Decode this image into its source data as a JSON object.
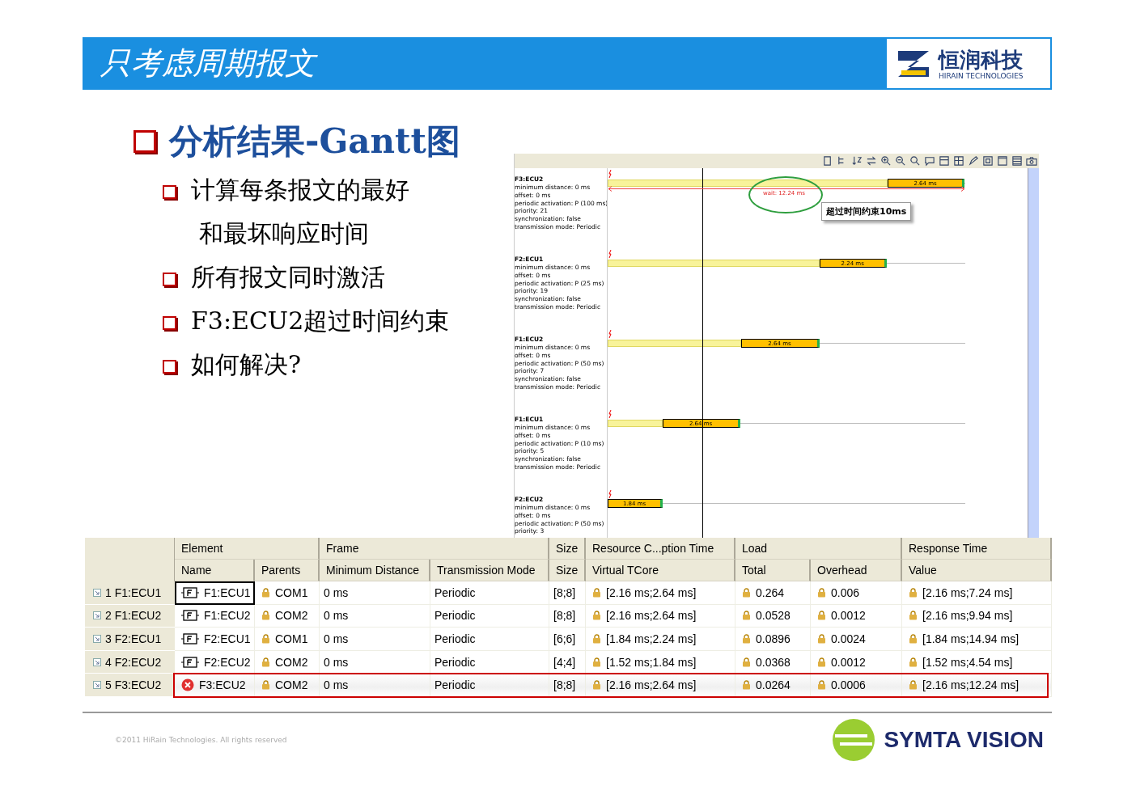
{
  "header": {
    "title": "只考虑周期报文",
    "logo": {
      "name": "恒润科技",
      "tagline": "HIRAIN TECHNOLOGIES"
    }
  },
  "heading": "分析结果-Gantt图",
  "bullets": [
    {
      "lines": [
        "计算每条报文的最好",
        "和最坏响应时间"
      ]
    },
    {
      "lines": [
        "所有报文同时激活"
      ]
    },
    {
      "lines": [
        "F3:ECU2超过时间约束"
      ]
    },
    {
      "lines": [
        "如何解决?"
      ]
    }
  ],
  "gantt": {
    "rows": [
      {
        "name": "F3:ECU2",
        "properties": [
          "minimum distance: 0 ms",
          "offset: 0 ms",
          "periodic activation: P (100 ms)",
          "priority: 21",
          "synchronization: false",
          "transmission mode: Periodic"
        ],
        "bar_label": "2.64 ms"
      },
      {
        "name": "F2:ECU1",
        "properties": [
          "minimum distance: 0 ms",
          "offset: 0 ms",
          "periodic activation: P (25 ms)",
          "priority: 19",
          "synchronization: false",
          "transmission mode: Periodic"
        ],
        "bar_label": "2.24 ms"
      },
      {
        "name": "F1:ECU2",
        "properties": [
          "minimum distance: 0 ms",
          "offset: 0 ms",
          "periodic activation: P (50 ms)",
          "priority: 7",
          "synchronization: false",
          "transmission mode: Periodic"
        ],
        "bar_label": "2.64 ms"
      },
      {
        "name": "F1:ECU1",
        "properties": [
          "minimum distance: 0 ms",
          "offset: 0 ms",
          "periodic activation: P (10 ms)",
          "priority: 5",
          "synchronization: false",
          "transmission mode: Periodic"
        ],
        "bar_label": "2.64 ms"
      },
      {
        "name": "F2:ECU2",
        "properties": [
          "minimum distance: 0 ms",
          "offset: 0 ms",
          "periodic activation: P (50 ms)",
          "priority: 3"
        ],
        "bar_label": "1.84 ms"
      }
    ],
    "wait_label": "wait: 12.24 ms",
    "callout": "超过时间约束10ms"
  },
  "table": {
    "groups": [
      {
        "label": "Element"
      },
      {
        "label": "Frame"
      },
      {
        "label": "Size"
      },
      {
        "label": "Resource C...ption Time"
      },
      {
        "label": "Load"
      },
      {
        "label": "Response Time"
      }
    ],
    "columns": [
      {
        "label": "Name"
      },
      {
        "label": "Parents"
      },
      {
        "label": "Minimum Distance"
      },
      {
        "label": "Transmission Mode"
      },
      {
        "label": "Size"
      },
      {
        "label": "Virtual TCore"
      },
      {
        "label": "Total"
      },
      {
        "label": "Overhead"
      },
      {
        "label": "Value"
      }
    ],
    "rows": [
      {
        "header": "1 F1:ECU1",
        "kind": "frame",
        "focused": true,
        "highlighted": false,
        "cells": [
          "F1:ECU1",
          "COM1",
          "0 ms",
          "Periodic",
          "[8;8]",
          "[2.16 ms;2.64 ms]",
          "0.264",
          "0.006",
          "[2.16 ms;7.24 ms]"
        ]
      },
      {
        "header": "2 F1:ECU2",
        "kind": "frame",
        "focused": false,
        "highlighted": false,
        "cells": [
          "F1:ECU2",
          "COM2",
          "0 ms",
          "Periodic",
          "[8;8]",
          "[2.16 ms;2.64 ms]",
          "0.0528",
          "0.0012",
          "[2.16 ms;9.94 ms]"
        ]
      },
      {
        "header": "3 F2:ECU1",
        "kind": "frame",
        "focused": false,
        "highlighted": false,
        "cells": [
          "F2:ECU1",
          "COM1",
          "0 ms",
          "Periodic",
          "[6;6]",
          "[1.84 ms;2.24 ms]",
          "0.0896",
          "0.0024",
          "[1.84 ms;14.94 ms]"
        ]
      },
      {
        "header": "4 F2:ECU2",
        "kind": "frame",
        "focused": false,
        "highlighted": false,
        "cells": [
          "F2:ECU2",
          "COM2",
          "0 ms",
          "Periodic",
          "[4;4]",
          "[1.52 ms;1.84 ms]",
          "0.0368",
          "0.0012",
          "[1.52 ms;4.54 ms]"
        ]
      },
      {
        "header": "5 F3:ECU2",
        "kind": "error",
        "focused": false,
        "highlighted": true,
        "cells": [
          "F3:ECU2",
          "COM2",
          "0 ms",
          "Periodic",
          "[8;8]",
          "[2.16 ms;2.64 ms]",
          "0.0264",
          "0.0006",
          "[2.16 ms;12.24 ms]"
        ]
      }
    ]
  },
  "footer": {
    "copyright": "©2011 HiRain Technologies. All rights reserved",
    "brand": "SYMTA VISION"
  }
}
